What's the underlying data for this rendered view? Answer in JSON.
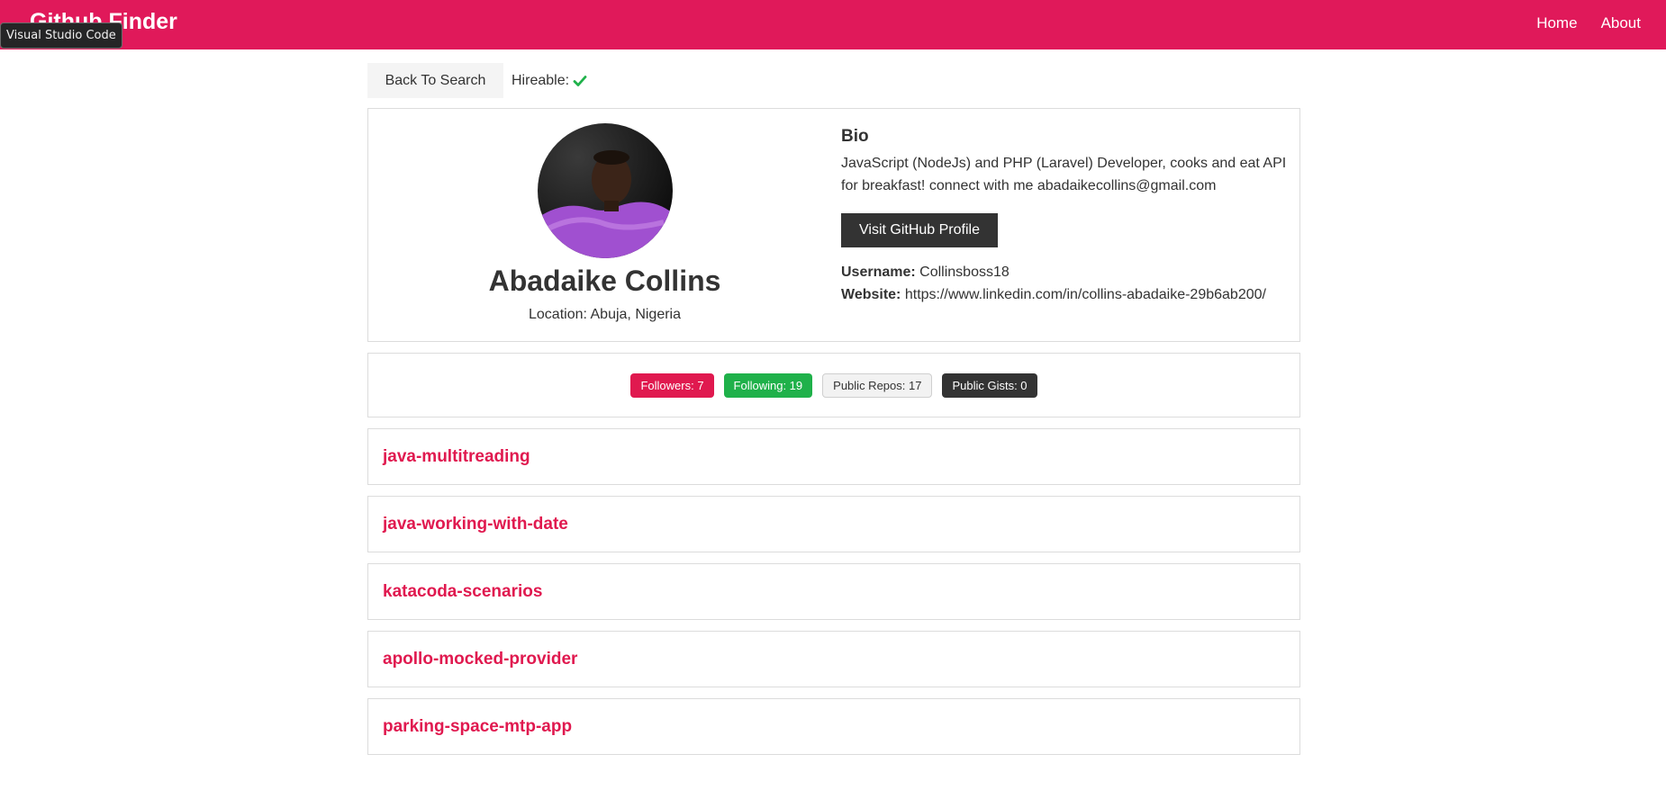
{
  "navbar": {
    "brand": "Github Finder",
    "links": [
      "Home",
      "About"
    ]
  },
  "tooltip": {
    "text": "Visual Studio Code"
  },
  "topbar": {
    "back_label": "Back To Search",
    "hireable_label": "Hireable:",
    "hireable_icon": "check-icon",
    "hireable_color": "#1fb14a"
  },
  "profile": {
    "name": "Abadaike Collins",
    "location": "Location: Abuja, Nigeria",
    "bio_title": "Bio",
    "bio": "JavaScript (NodeJs) and PHP (Laravel) Developer, cooks and eat API for breakfast! connect with me abadaikecollins@gmail.com",
    "visit_label": "Visit GitHub Profile",
    "username_label": "Username:",
    "username": "Collinsboss18",
    "website_label": "Website:",
    "website": "https://www.linkedin.com/in/collins-abadaike-29b6ab200/"
  },
  "stats": {
    "followers": "Followers: 7",
    "following": "Following: 19",
    "public_repos": "Public Repos: 17",
    "public_gists": "Public Gists: 0"
  },
  "repos": [
    "java-multitreading",
    "java-working-with-date",
    "katacoda-scenarios",
    "apollo-mocked-provider",
    "parking-space-mtp-app"
  ],
  "colors": {
    "accent": "#e0195a",
    "success": "#1fb14a",
    "dark": "#333333"
  }
}
